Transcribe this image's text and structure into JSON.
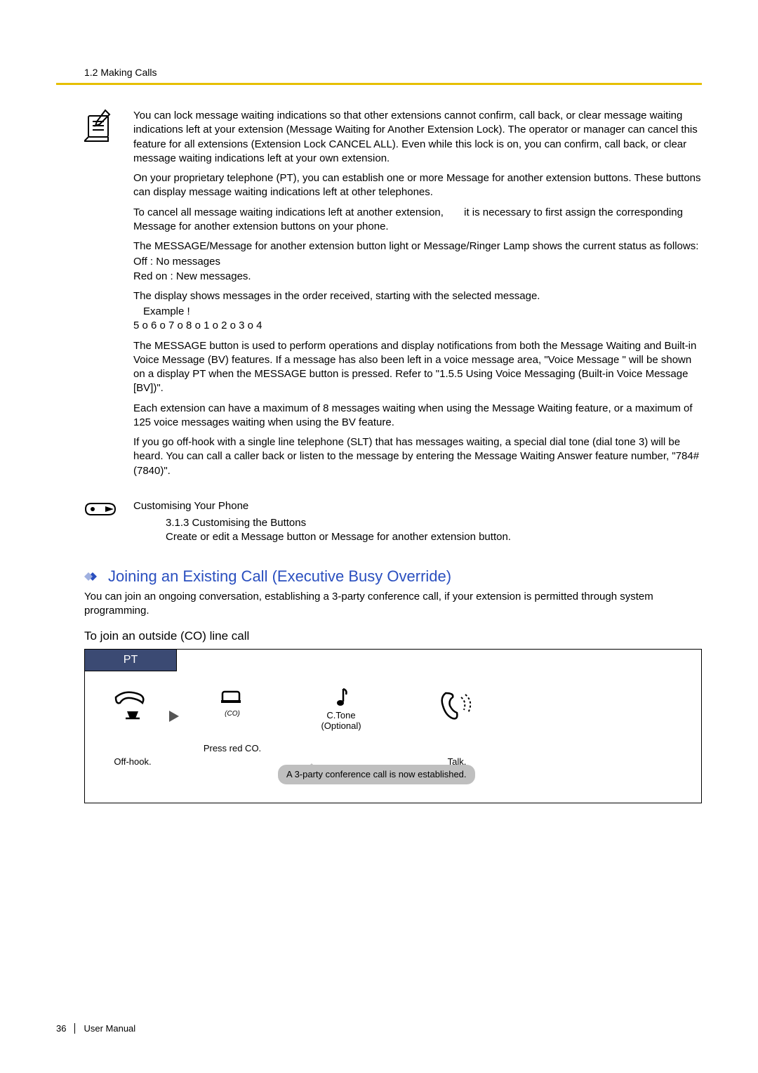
{
  "header": {
    "breadcrumb": "1.2 Making Calls"
  },
  "note": {
    "p1": "You can lock message waiting indications so that other extensions cannot confirm, call back, or clear message waiting indications left at your extension (Message Waiting for Another Extension Lock). The operator or manager can cancel this feature for all extensions (Extension Lock CANCEL ALL). Even while this lock is on, you can confirm, call back, or clear message waiting indications left at your own extension.",
    "p2": "On your proprietary telephone (PT), you can establish one or more Message for another extension buttons. These buttons can display message waiting indications left at other telephones.",
    "p3a": "To cancel all message waiting indications left at another extension,",
    "p3b": "it is necessary to first assign the corresponding Message for another extension buttons on your phone.",
    "p4": "The MESSAGE/Message for another extension button light or Message/Ringer Lamp shows the current status as follows:",
    "p4a": "Off : No messages",
    "p4b": "Red on : New messages.",
    "p5": "The display shows messages in the order received, starting with the selected message.",
    "p5a": "Example  !",
    "p5b": "5 o 6 o 7 o 8 o 1 o 2 o 3 o 4",
    "p6": "The MESSAGE button is used to perform operations and display notifications from both the Message Waiting and Built-in Voice Message (BV) features. If a message has also been left in a voice message area, \"Voice Message   \" will be shown on a display PT when the MESSAGE button is pressed. Refer to \"1.5.5 Using Voice Messaging (Built-in Voice Message [BV])\".",
    "p7": "Each extension can have a maximum of 8 messages waiting when using the Message Waiting feature, or a maximum of 125 voice messages waiting when using the BV feature.",
    "p8": "If you go off-hook with a single line telephone (SLT) that has messages waiting, a special dial tone (dial tone 3) will be heard. You can call a caller back or listen to the message by entering the Message Waiting Answer feature number, \"784# (7840)\"."
  },
  "customise": {
    "heading": "Customising Your Phone",
    "line1": "3.1.3 Customising the Buttons",
    "line2": "Create or edit a Message button or Message for another extension button."
  },
  "section": {
    "title": "Joining an Existing Call (Executive Busy Override)",
    "desc": "You can join an ongoing conversation, establishing a 3-party conference call, if your extension is permitted through system programming.",
    "subhead": "To join an outside (CO) line call"
  },
  "diagram": {
    "tab": "PT",
    "step1": "Off-hook.",
    "step2": "Press red CO.",
    "co_small": "(CO)",
    "ctone1": "C.Tone",
    "ctone2": "(Optional)",
    "bubble": "A 3-party conference call is now established.",
    "step4": "Talk."
  },
  "footer": {
    "page": "36",
    "label": "User Manual"
  }
}
